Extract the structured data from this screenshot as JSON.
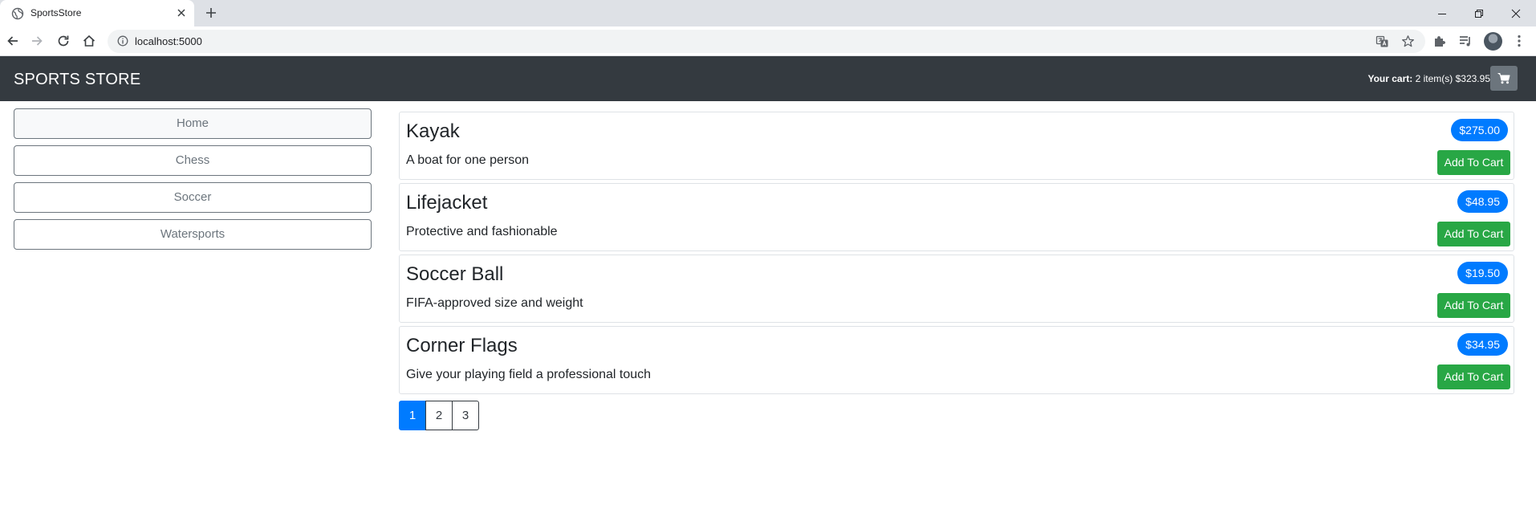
{
  "browser": {
    "tab_title": "SportsStore",
    "url": "localhost:5000"
  },
  "header": {
    "brand": "SPORTS STORE",
    "cart_label": "Your cart:",
    "cart_summary": "2 item(s) $323.95"
  },
  "categories": [
    {
      "label": "Home",
      "active": true
    },
    {
      "label": "Chess",
      "active": false
    },
    {
      "label": "Soccer",
      "active": false
    },
    {
      "label": "Watersports",
      "active": false
    }
  ],
  "products": [
    {
      "name": "Kayak",
      "description": "A boat for one person",
      "price": "$275.00",
      "button": "Add To Cart"
    },
    {
      "name": "Lifejacket",
      "description": "Protective and fashionable",
      "price": "$48.95",
      "button": "Add To Cart"
    },
    {
      "name": "Soccer Ball",
      "description": "FIFA-approved size and weight",
      "price": "$19.50",
      "button": "Add To Cart"
    },
    {
      "name": "Corner Flags",
      "description": "Give your playing field a professional touch",
      "price": "$34.95",
      "button": "Add To Cart"
    }
  ],
  "pagination": {
    "pages": [
      "1",
      "2",
      "3"
    ],
    "current": "1"
  },
  "colors": {
    "navbar": "#343a40",
    "primary": "#007bff",
    "success": "#28a745",
    "secondary": "#6c757d"
  }
}
